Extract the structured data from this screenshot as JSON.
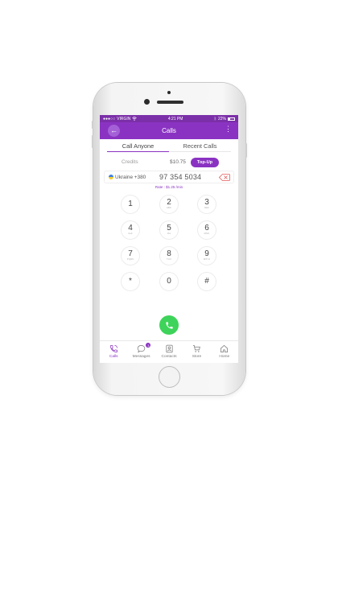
{
  "status_bar": {
    "signal": "●●●○○",
    "carrier": "VIRGIN",
    "time": "4:21 PM",
    "battery_text": "22%",
    "battery_level": 0.22
  },
  "app_bar": {
    "title": "Calls",
    "back_glyph": "←",
    "more_glyph": "⋮"
  },
  "tabs": [
    {
      "label": "Call Anyone",
      "active": true
    },
    {
      "label": "Recent Calls",
      "active": false
    }
  ],
  "credits": {
    "label": "Credits",
    "amount": "$10.75",
    "topup_label": "Top-Up"
  },
  "dial": {
    "country": "Ukraine +380",
    "number": "97 354 5034",
    "rate": "Rate : $1.25 /min"
  },
  "keypad": [
    {
      "digit": "1",
      "letters": ""
    },
    {
      "digit": "2",
      "letters": "ABC"
    },
    {
      "digit": "3",
      "letters": "DEF"
    },
    {
      "digit": "4",
      "letters": "GHI"
    },
    {
      "digit": "5",
      "letters": "JKL"
    },
    {
      "digit": "6",
      "letters": "MNO"
    },
    {
      "digit": "7",
      "letters": "PQRS"
    },
    {
      "digit": "8",
      "letters": "TUV"
    },
    {
      "digit": "9",
      "letters": "WXYZ"
    },
    {
      "digit": "*",
      "letters": ""
    },
    {
      "digit": "0",
      "letters": ""
    },
    {
      "digit": "#",
      "letters": ""
    }
  ],
  "bottom_nav": [
    {
      "label": "Calls",
      "icon": "phone-icon",
      "active": true
    },
    {
      "label": "Messages",
      "icon": "chat-icon",
      "badge": "3",
      "active": false
    },
    {
      "label": "Contacts",
      "icon": "contacts-icon",
      "active": false
    },
    {
      "label": "Store",
      "icon": "cart-icon",
      "active": false
    },
    {
      "label": "Home",
      "icon": "home-icon",
      "active": false
    }
  ],
  "colors": {
    "accent": "#8a33c2",
    "status_bar": "#7b2fa8",
    "call_green": "#3ed35a",
    "delete_red": "#e25b5b"
  }
}
